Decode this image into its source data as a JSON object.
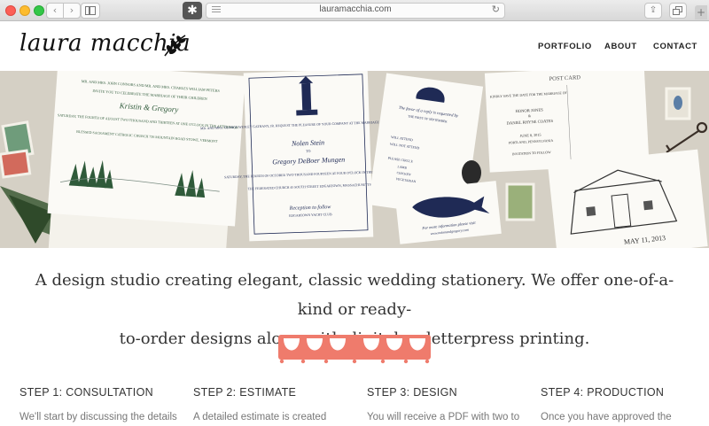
{
  "browser": {
    "url": "lauramacchia.com",
    "back_icon": "chevron-left-icon",
    "forward_icon": "chevron-right-icon",
    "extension_glyph": "✱"
  },
  "site": {
    "logo": "laura macchia",
    "nav": [
      {
        "label": "PORTFOLIO"
      },
      {
        "label": "ABOUT"
      },
      {
        "label": "CONTACT"
      }
    ]
  },
  "hero": {
    "card1": {
      "parents": "MR. AND MRS. JOHN CONNORS AND MR. AND MRS. CHARLES WILLIAM PETERS",
      "invite": "INVITE YOU TO CELEBRATE THE MARRIAGE OF THEIR CHILDREN",
      "names": "Kristin & Gregory",
      "details": "SATURDAY, THE FOURTH OF AUGUST TWO THOUSAND AND THIRTEEN AT ONE O'CLOCK IN THE AFTERNOON",
      "venue": "BLESSED SACRAMENT CATHOLIC CHURCH 726 MOUNTAIN ROAD STOWE, VERMONT"
    },
    "card2": {
      "parents": "MR. AND MRS. GEORGE WESLEY GATHANY, JR. REQUEST THE PLEASURE OF YOUR COMPANY AT THE MARRIAGE OF THEIR DAUGHTER",
      "bride": "Nolen Stein",
      "to": "TO",
      "groom": "Gregory DeBoer Mungen",
      "details": "SATURDAY, THE FOURTH OF OCTOBER TWO THOUSAND FOURTEEN AT FOUR O'CLOCK IN THE AFTERNOON",
      "venue": "THE FEDERATED CHURCH 45 SOUTH STREET EDGARTOWN, MASSACHUSETTS",
      "reception": "Reception to follow",
      "club": "EDGARTOWN YACHT CLUB"
    },
    "card3": {
      "favor": "The favor of a reply is requested by",
      "date": "THE FIRST OF SEPTEMBER",
      "will_attend": "WILL ATTEND",
      "will_not": "WILL NOT ATTEND",
      "please": "PLEASE CIRCLE",
      "o1": "LAMB",
      "o2": "CHICKEN",
      "o3": "VEGETARIAN"
    },
    "card4": {
      "line1": "For more information please visit",
      "line2": "www.nolenandgregory.com"
    },
    "card5": {
      "header": "POST CARD",
      "save": "KINDLY SAVE THE DATE FOR THE MARRIAGE OF",
      "n1": "HONOR JONES",
      "and": "&",
      "n2": "DANIEL RHYNE COATES",
      "date": "JUNE 8, 2015",
      "place": "PORTLAND, PENNSYLVANIA",
      "inv": "INVITATION TO FOLLOW"
    },
    "card6": {
      "date": "MAY 11, 2013"
    },
    "colors": {
      "navy": "#1f2a55",
      "green": "#2f5a3a",
      "pink": "#e89a8e"
    }
  },
  "intro": {
    "line1": "A design studio creating elegant, classic wedding stationery. We offer one-of-a-kind or ready-",
    "line2": "to-order designs along with digital or letterpress printing.",
    "accent_color": "#ef7b6c"
  },
  "steps": [
    {
      "title": "STEP 1: CONSULTATION",
      "desc": "We'll start by discussing the details"
    },
    {
      "title": "STEP 2: ESTIMATE",
      "desc": "A detailed estimate is created"
    },
    {
      "title": "STEP 3: DESIGN",
      "desc": "You will receive a PDF with two to"
    },
    {
      "title": "STEP 4: PRODUCTION",
      "desc": "Once you have approved the"
    }
  ]
}
